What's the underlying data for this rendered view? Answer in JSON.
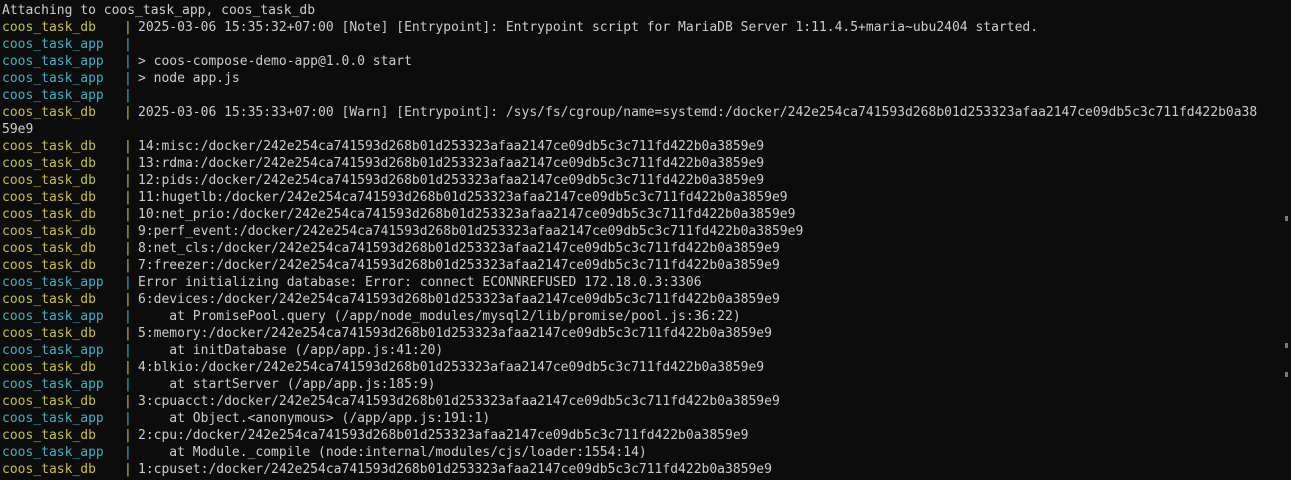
{
  "terminal": {
    "header": "Attaching to coos_task_app, coos_task_db",
    "separator": "|",
    "lines": [
      {
        "service": "coos_task_db",
        "kind": "db",
        "text": "2025-03-06 15:35:32+07:00 [Note] [Entrypoint]: Entrypoint script for MariaDB Server 1:11.4.5+maria~ubu2404 started."
      },
      {
        "service": "coos_task_app",
        "kind": "app",
        "text": ""
      },
      {
        "service": "coos_task_app",
        "kind": "app",
        "text": "> coos-compose-demo-app@1.0.0 start"
      },
      {
        "service": "coos_task_app",
        "kind": "app",
        "text": "> node app.js"
      },
      {
        "service": "coos_task_app",
        "kind": "app",
        "text": ""
      },
      {
        "service": "coos_task_db",
        "kind": "db",
        "text": "2025-03-06 15:35:33+07:00 [Warn] [Entrypoint]: /sys/fs/cgroup/name=systemd:/docker/242e254ca741593d268b01d253323afaa2147ce09db5c3c711fd422b0a38"
      },
      {
        "service": "",
        "kind": "wrap",
        "text": "59e9"
      },
      {
        "service": "coos_task_db",
        "kind": "db",
        "text": "14:misc:/docker/242e254ca741593d268b01d253323afaa2147ce09db5c3c711fd422b0a3859e9"
      },
      {
        "service": "coos_task_db",
        "kind": "db",
        "text": "13:rdma:/docker/242e254ca741593d268b01d253323afaa2147ce09db5c3c711fd422b0a3859e9"
      },
      {
        "service": "coos_task_db",
        "kind": "db",
        "text": "12:pids:/docker/242e254ca741593d268b01d253323afaa2147ce09db5c3c711fd422b0a3859e9"
      },
      {
        "service": "coos_task_db",
        "kind": "db",
        "text": "11:hugetlb:/docker/242e254ca741593d268b01d253323afaa2147ce09db5c3c711fd422b0a3859e9"
      },
      {
        "service": "coos_task_db",
        "kind": "db",
        "text": "10:net_prio:/docker/242e254ca741593d268b01d253323afaa2147ce09db5c3c711fd422b0a3859e9"
      },
      {
        "service": "coos_task_db",
        "kind": "db",
        "text": "9:perf_event:/docker/242e254ca741593d268b01d253323afaa2147ce09db5c3c711fd422b0a3859e9"
      },
      {
        "service": "coos_task_db",
        "kind": "db",
        "text": "8:net_cls:/docker/242e254ca741593d268b01d253323afaa2147ce09db5c3c711fd422b0a3859e9"
      },
      {
        "service": "coos_task_db",
        "kind": "db",
        "text": "7:freezer:/docker/242e254ca741593d268b01d253323afaa2147ce09db5c3c711fd422b0a3859e9"
      },
      {
        "service": "coos_task_app",
        "kind": "app",
        "text": "Error initializing database: Error: connect ECONNREFUSED 172.18.0.3:3306"
      },
      {
        "service": "coos_task_db",
        "kind": "db",
        "text": "6:devices:/docker/242e254ca741593d268b01d253323afaa2147ce09db5c3c711fd422b0a3859e9"
      },
      {
        "service": "coos_task_app",
        "kind": "app",
        "text": "    at PromisePool.query (/app/node_modules/mysql2/lib/promise/pool.js:36:22)"
      },
      {
        "service": "coos_task_db",
        "kind": "db",
        "text": "5:memory:/docker/242e254ca741593d268b01d253323afaa2147ce09db5c3c711fd422b0a3859e9"
      },
      {
        "service": "coos_task_app",
        "kind": "app",
        "text": "    at initDatabase (/app/app.js:41:20)"
      },
      {
        "service": "coos_task_db",
        "kind": "db",
        "text": "4:blkio:/docker/242e254ca741593d268b01d253323afaa2147ce09db5c3c711fd422b0a3859e9"
      },
      {
        "service": "coos_task_app",
        "kind": "app",
        "text": "    at startServer (/app/app.js:185:9)"
      },
      {
        "service": "coos_task_db",
        "kind": "db",
        "text": "3:cpuacct:/docker/242e254ca741593d268b01d253323afaa2147ce09db5c3c711fd422b0a3859e9"
      },
      {
        "service": "coos_task_app",
        "kind": "app",
        "text": "    at Object.<anonymous> (/app/app.js:191:1)"
      },
      {
        "service": "coos_task_db",
        "kind": "db",
        "text": "2:cpu:/docker/242e254ca741593d268b01d253323afaa2147ce09db5c3c711fd422b0a3859e9"
      },
      {
        "service": "coos_task_app",
        "kind": "app",
        "text": "    at Module._compile (node:internal/modules/cjs/loader:1554:14)"
      },
      {
        "service": "coos_task_db",
        "kind": "db",
        "text": "1:cpuset:/docker/242e254ca741593d268b01d253323afaa2147ce09db5c3c711fd422b0a3859e9"
      }
    ]
  }
}
